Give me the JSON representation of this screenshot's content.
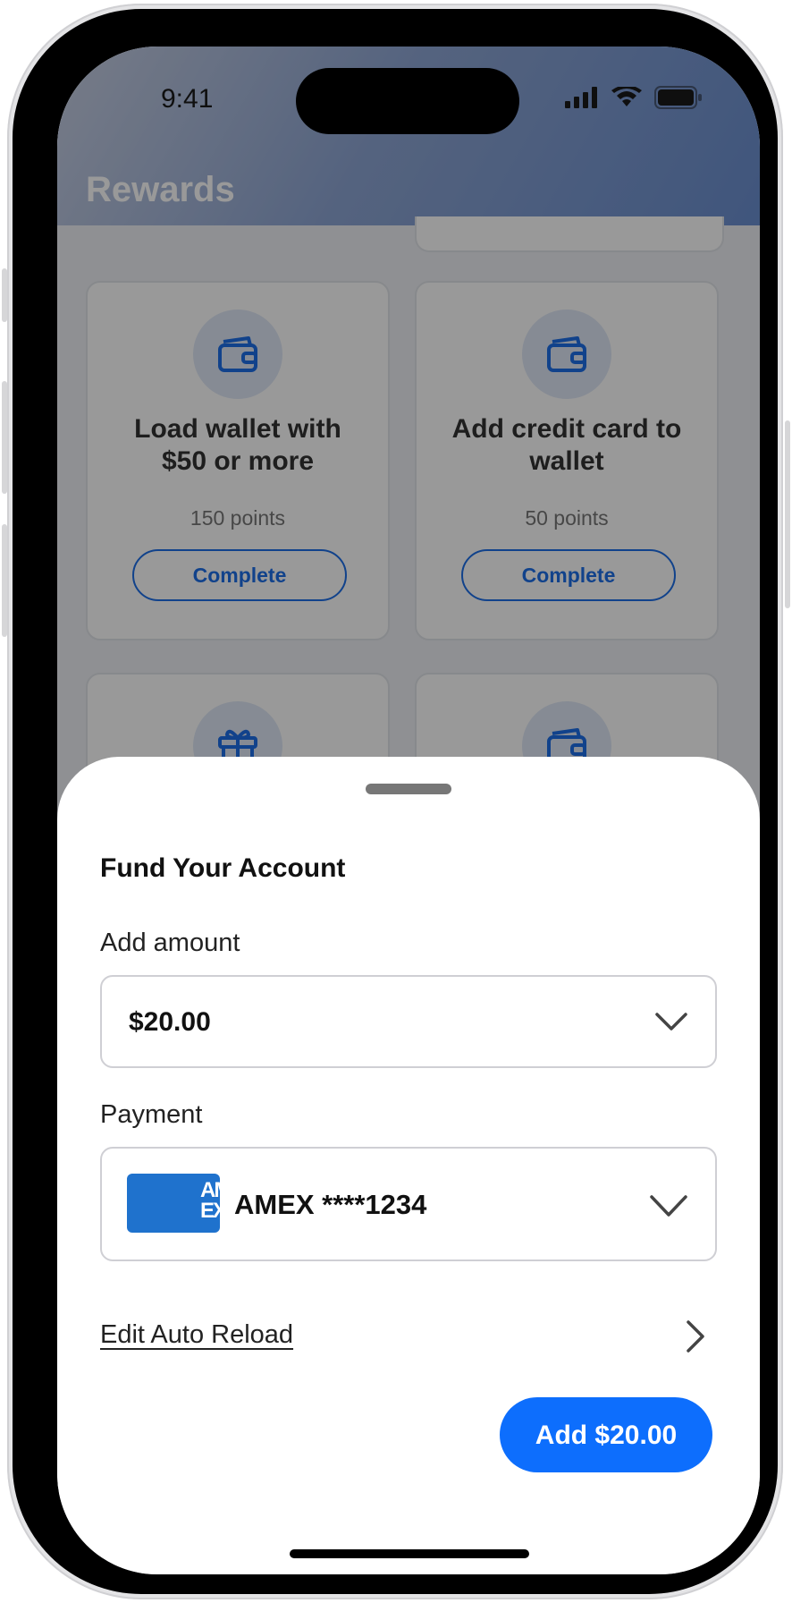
{
  "status_bar": {
    "time": "9:41"
  },
  "header": {
    "title": "Rewards"
  },
  "tasks": [
    {
      "icon": "wallet-icon",
      "title_line1": "Load wallet with",
      "title_line2": "$50 or more",
      "points": "150 points",
      "button": "Complete"
    },
    {
      "icon": "wallet-icon",
      "title_line1": "Add credit card to",
      "title_line2": "wallet",
      "points": "50 points",
      "button": "Complete"
    },
    {
      "icon": "gift-icon"
    },
    {
      "icon": "wallet-icon"
    }
  ],
  "sheet": {
    "title": "Fund Your Account",
    "amount_label": "Add amount",
    "amount_value": "$20.00",
    "payment_label": "Payment",
    "card_brand_logo_text": "AMEX",
    "payment_value": "AMEX ****1234",
    "auto_reload_link": "Edit Auto Reload",
    "submit_button": "Add $20.00"
  },
  "colors": {
    "primary": "#0d6efd",
    "amex_blue": "#1f72cd",
    "overlay": "rgba(0,0,0,0.4)"
  }
}
